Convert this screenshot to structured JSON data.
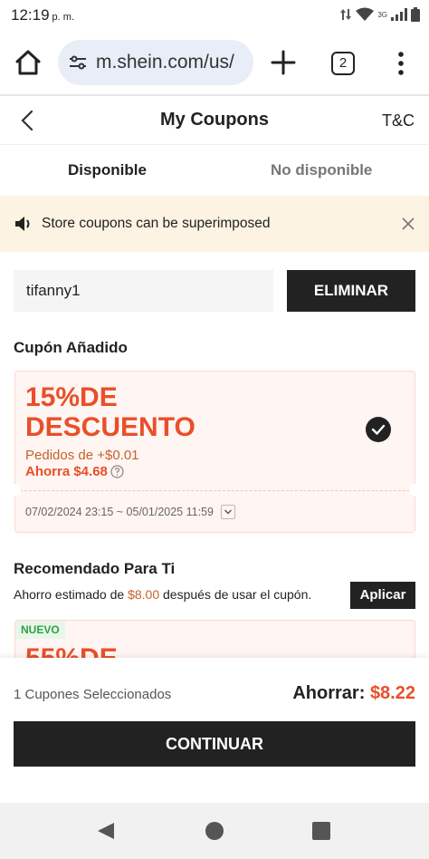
{
  "status_bar": {
    "time": "12:19",
    "period": "p. m.",
    "network": "3G"
  },
  "browser": {
    "url": "m.shein.com/us/",
    "tab_count": "2"
  },
  "header": {
    "title": "My Coupons",
    "tc_label": "T&C"
  },
  "tabs": [
    {
      "label": "Disponible",
      "active": true
    },
    {
      "label": "No disponible",
      "active": false
    }
  ],
  "notice": {
    "text": "Store coupons can be superimposed"
  },
  "code_entry": {
    "value": "tifanny1",
    "button_label": "ELIMINAR"
  },
  "added_section": {
    "title": "Cupón Añadido",
    "coupon": {
      "headline_line1": "15%DE",
      "headline_line2": "DESCUENTO",
      "condition": "Pedidos de +$0.01",
      "savings": "Ahorra $4.68",
      "validity": "07/02/2024 23:15 ~ 05/01/2025 11:59",
      "selected": true
    }
  },
  "recommended_section": {
    "title": "Recomendado Para Ti",
    "estimate_prefix": "Ahorro estimado de ",
    "estimate_amount": "$8.00",
    "estimate_suffix": " después de usar el cupón.",
    "apply_label": "Aplicar",
    "coupon": {
      "badge": "NUEVO",
      "headline": "55%DE"
    }
  },
  "footer": {
    "selected_text": "1 Cupones Seleccionados",
    "savings_label": "Ahorrar:",
    "savings_value": "$8.22",
    "continue_label": "CONTINUAR"
  },
  "colors": {
    "accent": "#e8502a",
    "dark": "#222222",
    "notice_bg": "#fdf3e2",
    "coupon_bg": "#fff5f2"
  }
}
